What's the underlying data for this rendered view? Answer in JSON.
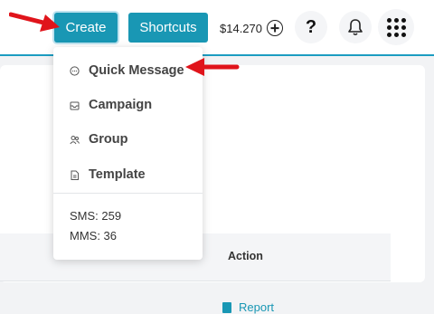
{
  "topbar": {
    "create_label": "Create",
    "shortcuts_label": "Shortcuts",
    "balance": "$14.270",
    "help_label": "?"
  },
  "dropdown": {
    "items": [
      {
        "label": "Quick Message",
        "icon": "chat-bubble-icon"
      },
      {
        "label": "Campaign",
        "icon": "inbox-icon"
      },
      {
        "label": "Group",
        "icon": "users-icon"
      },
      {
        "label": "Template",
        "icon": "document-icon"
      }
    ],
    "sms": "SMS: 259",
    "mms": "MMS: 36"
  },
  "table": {
    "action_header": "Action",
    "report_link": "Report"
  },
  "colors": {
    "accent": "#1997b4",
    "annotation_arrow": "#e0141b"
  }
}
